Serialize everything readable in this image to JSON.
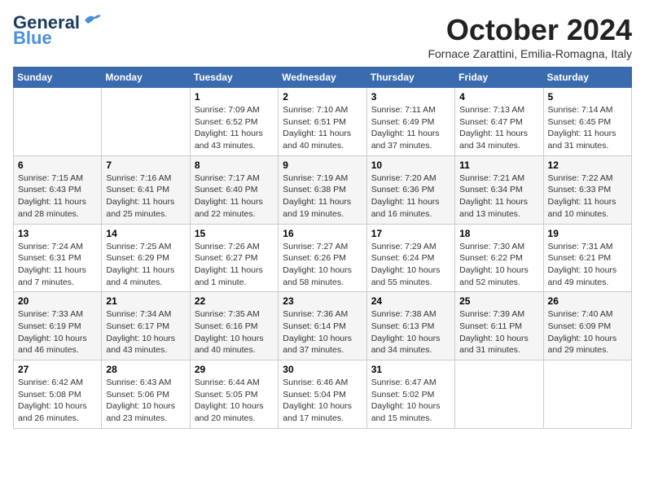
{
  "header": {
    "logo_line1": "General",
    "logo_line2": "Blue",
    "month_title": "October 2024",
    "subtitle": "Fornace Zarattini, Emilia-Romagna, Italy"
  },
  "weekdays": [
    "Sunday",
    "Monday",
    "Tuesday",
    "Wednesday",
    "Thursday",
    "Friday",
    "Saturday"
  ],
  "weeks": [
    [
      null,
      null,
      {
        "day": "1",
        "sunrise": "7:09 AM",
        "sunset": "6:52 PM",
        "daylight": "11 hours and 43 minutes"
      },
      {
        "day": "2",
        "sunrise": "7:10 AM",
        "sunset": "6:51 PM",
        "daylight": "11 hours and 40 minutes"
      },
      {
        "day": "3",
        "sunrise": "7:11 AM",
        "sunset": "6:49 PM",
        "daylight": "11 hours and 37 minutes"
      },
      {
        "day": "4",
        "sunrise": "7:13 AM",
        "sunset": "6:47 PM",
        "daylight": "11 hours and 34 minutes"
      },
      {
        "day": "5",
        "sunrise": "7:14 AM",
        "sunset": "6:45 PM",
        "daylight": "11 hours and 31 minutes"
      }
    ],
    [
      {
        "day": "6",
        "sunrise": "7:15 AM",
        "sunset": "6:43 PM",
        "daylight": "11 hours and 28 minutes"
      },
      {
        "day": "7",
        "sunrise": "7:16 AM",
        "sunset": "6:41 PM",
        "daylight": "11 hours and 25 minutes"
      },
      {
        "day": "8",
        "sunrise": "7:17 AM",
        "sunset": "6:40 PM",
        "daylight": "11 hours and 22 minutes"
      },
      {
        "day": "9",
        "sunrise": "7:19 AM",
        "sunset": "6:38 PM",
        "daylight": "11 hours and 19 minutes"
      },
      {
        "day": "10",
        "sunrise": "7:20 AM",
        "sunset": "6:36 PM",
        "daylight": "11 hours and 16 minutes"
      },
      {
        "day": "11",
        "sunrise": "7:21 AM",
        "sunset": "6:34 PM",
        "daylight": "11 hours and 13 minutes"
      },
      {
        "day": "12",
        "sunrise": "7:22 AM",
        "sunset": "6:33 PM",
        "daylight": "11 hours and 10 minutes"
      }
    ],
    [
      {
        "day": "13",
        "sunrise": "7:24 AM",
        "sunset": "6:31 PM",
        "daylight": "11 hours and 7 minutes"
      },
      {
        "day": "14",
        "sunrise": "7:25 AM",
        "sunset": "6:29 PM",
        "daylight": "11 hours and 4 minutes"
      },
      {
        "day": "15",
        "sunrise": "7:26 AM",
        "sunset": "6:27 PM",
        "daylight": "11 hours and 1 minute"
      },
      {
        "day": "16",
        "sunrise": "7:27 AM",
        "sunset": "6:26 PM",
        "daylight": "10 hours and 58 minutes"
      },
      {
        "day": "17",
        "sunrise": "7:29 AM",
        "sunset": "6:24 PM",
        "daylight": "10 hours and 55 minutes"
      },
      {
        "day": "18",
        "sunrise": "7:30 AM",
        "sunset": "6:22 PM",
        "daylight": "10 hours and 52 minutes"
      },
      {
        "day": "19",
        "sunrise": "7:31 AM",
        "sunset": "6:21 PM",
        "daylight": "10 hours and 49 minutes"
      }
    ],
    [
      {
        "day": "20",
        "sunrise": "7:33 AM",
        "sunset": "6:19 PM",
        "daylight": "10 hours and 46 minutes"
      },
      {
        "day": "21",
        "sunrise": "7:34 AM",
        "sunset": "6:17 PM",
        "daylight": "10 hours and 43 minutes"
      },
      {
        "day": "22",
        "sunrise": "7:35 AM",
        "sunset": "6:16 PM",
        "daylight": "10 hours and 40 minutes"
      },
      {
        "day": "23",
        "sunrise": "7:36 AM",
        "sunset": "6:14 PM",
        "daylight": "10 hours and 37 minutes"
      },
      {
        "day": "24",
        "sunrise": "7:38 AM",
        "sunset": "6:13 PM",
        "daylight": "10 hours and 34 minutes"
      },
      {
        "day": "25",
        "sunrise": "7:39 AM",
        "sunset": "6:11 PM",
        "daylight": "10 hours and 31 minutes"
      },
      {
        "day": "26",
        "sunrise": "7:40 AM",
        "sunset": "6:09 PM",
        "daylight": "10 hours and 29 minutes"
      }
    ],
    [
      {
        "day": "27",
        "sunrise": "6:42 AM",
        "sunset": "5:08 PM",
        "daylight": "10 hours and 26 minutes"
      },
      {
        "day": "28",
        "sunrise": "6:43 AM",
        "sunset": "5:06 PM",
        "daylight": "10 hours and 23 minutes"
      },
      {
        "day": "29",
        "sunrise": "6:44 AM",
        "sunset": "5:05 PM",
        "daylight": "10 hours and 20 minutes"
      },
      {
        "day": "30",
        "sunrise": "6:46 AM",
        "sunset": "5:04 PM",
        "daylight": "10 hours and 17 minutes"
      },
      {
        "day": "31",
        "sunrise": "6:47 AM",
        "sunset": "5:02 PM",
        "daylight": "10 hours and 15 minutes"
      },
      null,
      null
    ]
  ]
}
